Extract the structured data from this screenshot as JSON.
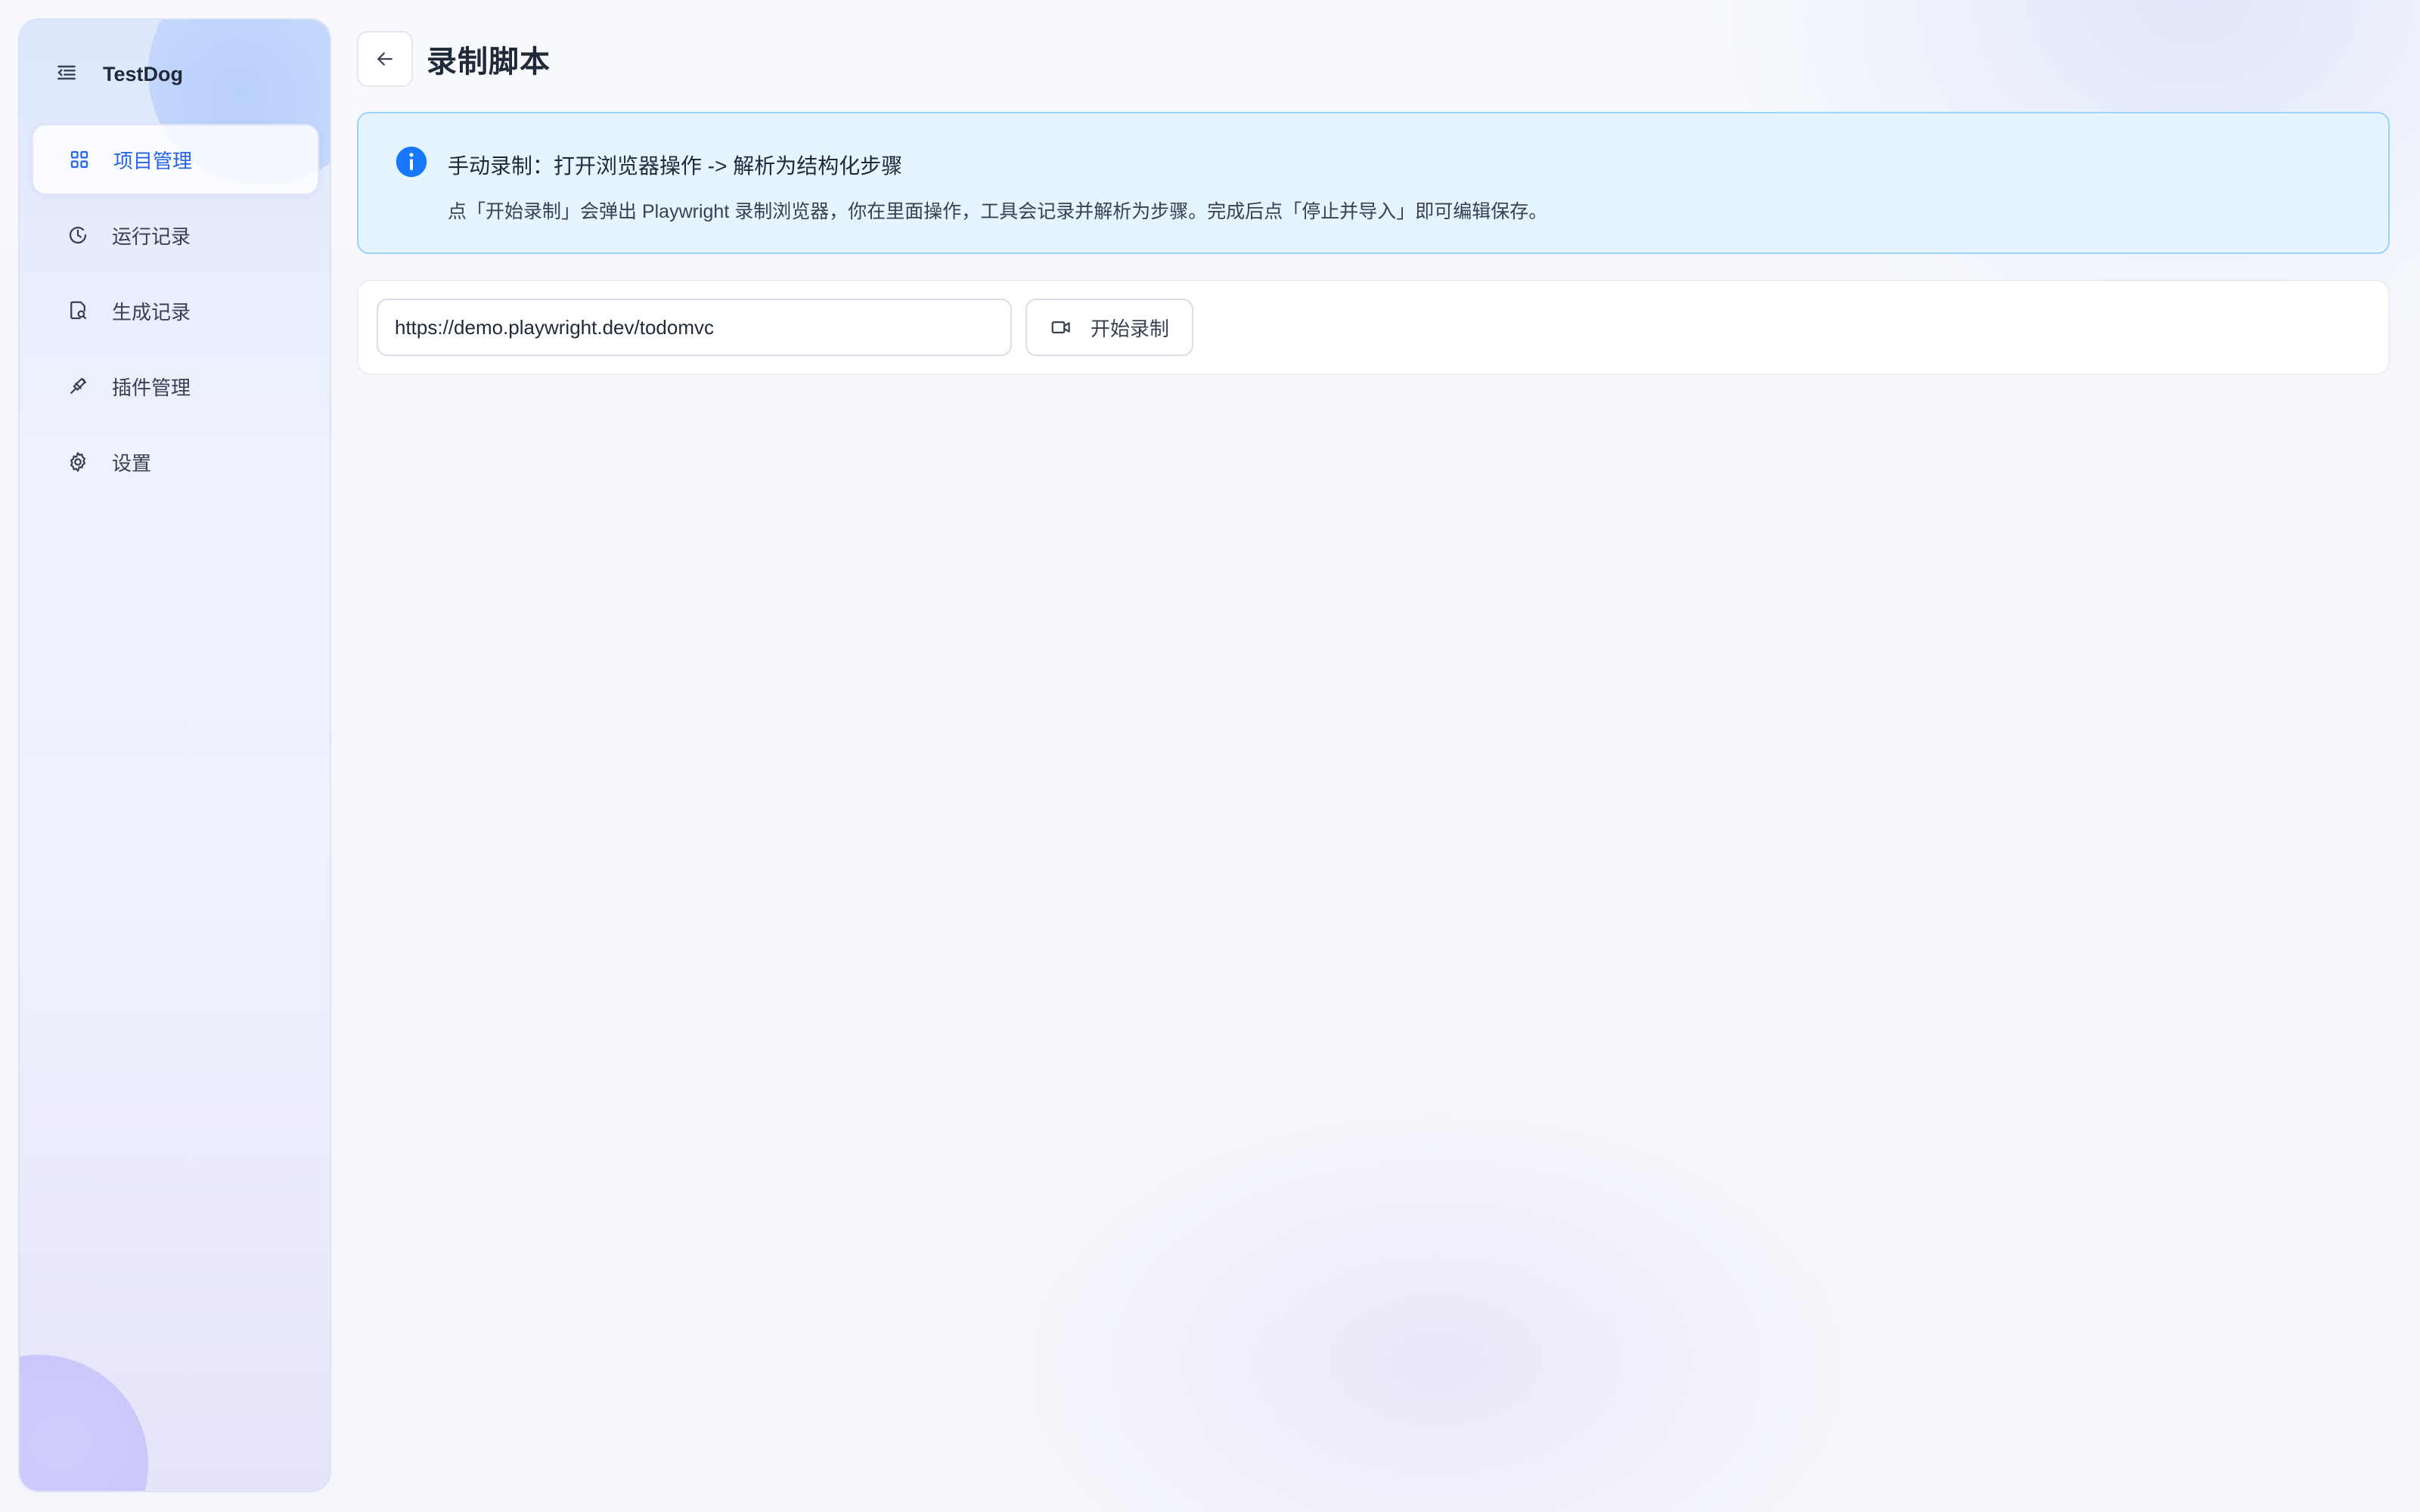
{
  "sidebar": {
    "brand": "TestDog",
    "items": [
      {
        "label": "项目管理",
        "icon": "grid-icon",
        "active": true
      },
      {
        "label": "运行记录",
        "icon": "clock-icon",
        "active": false
      },
      {
        "label": "生成记录",
        "icon": "file-search-icon",
        "active": false
      },
      {
        "label": "插件管理",
        "icon": "plugin-icon",
        "active": false
      },
      {
        "label": "设置",
        "icon": "gear-icon",
        "active": false
      }
    ]
  },
  "header": {
    "title": "录制脚本"
  },
  "alert": {
    "title": "手动录制：打开浏览器操作 -> 解析为结构化步骤",
    "description": "点「开始录制」会弹出 Playwright 录制浏览器，你在里面操作，工具会记录并解析为步骤。完成后点「停止并导入」即可编辑保存。"
  },
  "recorder": {
    "url_value": "https://demo.playwright.dev/todomvc",
    "start_label": "开始录制"
  },
  "colors": {
    "accent": "#2563eb",
    "info_bg": "#e6f4ff",
    "info_border": "#9cd3ff",
    "info_icon": "#1677ff"
  }
}
